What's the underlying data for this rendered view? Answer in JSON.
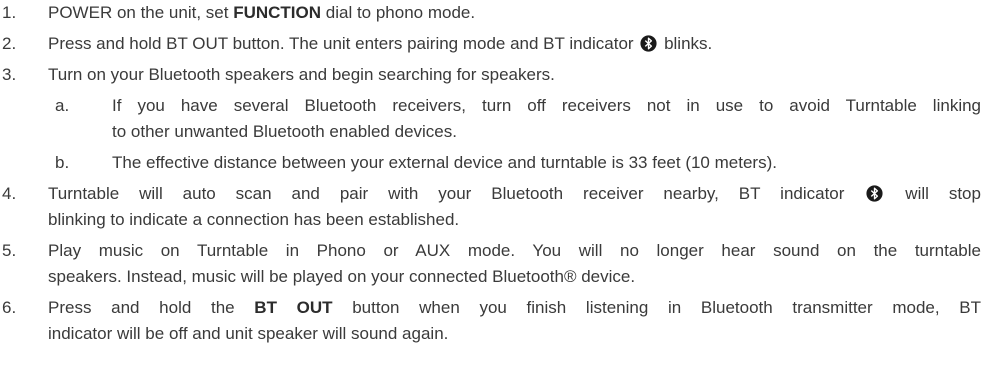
{
  "steps": [
    {
      "num": "1.",
      "pre": "POWER on the unit, set ",
      "bold": "FUNCTION",
      "post": " dial to phono mode."
    },
    {
      "num": "2.",
      "pre": "Press and hold BT OUT button. The unit enters pairing mode and BT indicator",
      "post": "blinks."
    },
    {
      "num": "3.",
      "text": "Turn on your Bluetooth speakers and begin searching for speakers.",
      "subs": [
        {
          "letter": "a.",
          "line1": "If you have several Bluetooth receivers, turn off receivers not in use to avoid Turntable linking",
          "line2": "to other unwanted Bluetooth enabled devices."
        },
        {
          "letter": "b.",
          "line1": "The effective distance between your external device and turntable is 33 feet (10 meters)."
        }
      ]
    },
    {
      "num": "4.",
      "line1_pre": "Turntable will auto scan and pair with your Bluetooth receiver nearby, BT indicator",
      "line1_post": "will stop",
      "line2": "blinking to indicate a connection has been established."
    },
    {
      "num": "5.",
      "line1": "Play music on Turntable in Phono or AUX mode. You will no longer hear sound on the turntable",
      "line2": "speakers. Instead, music will be played on your connected Bluetooth® device."
    },
    {
      "num": "6.",
      "line1_pre": "Press and hold the ",
      "line1_bold": "BT OUT",
      "line1_post": " button when you finish listening in Bluetooth transmitter mode, BT",
      "line2": "indicator will be off and unit speaker will sound again."
    }
  ],
  "icons": {
    "bluetooth": "bluetooth-icon"
  },
  "colors": {
    "text": "#3a3a3a",
    "icon_bg": "#1a1a1a"
  }
}
